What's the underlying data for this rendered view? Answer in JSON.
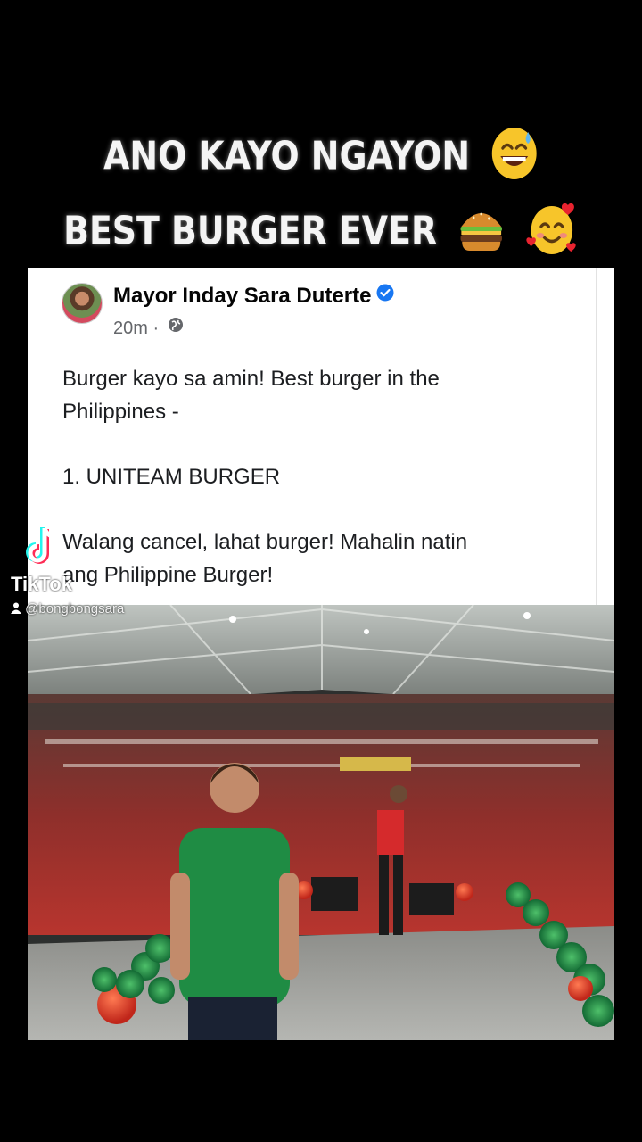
{
  "caption": {
    "line1": "ANO KAYO NGAYON",
    "line1_emoji": "grinning-sweat-emoji",
    "line2": "BEST BURGER EVER",
    "line2_emojis": [
      "hamburger-emoji",
      "smiling-face-with-hearts-emoji"
    ]
  },
  "post": {
    "author": "Mayor Inday Sara Duterte",
    "verified_icon": "verified-badge-icon",
    "time": "20m",
    "separator": "·",
    "privacy_icon": "globe-icon",
    "paragraph1": "Burger kayo sa amin! Best burger in the\nPhilippines -",
    "paragraph2": "1. UNITEAM BURGER",
    "paragraph3": "Walang cancel, lahat burger! Mahalin natin\nang Philippine Burger!"
  },
  "watermark": {
    "brand": "TikTok",
    "user_icon": "person-icon",
    "handle": "@bongbongsara"
  },
  "colors": {
    "background": "#000000",
    "verified_blue": "#1877f2",
    "meta_gray": "#65676b",
    "balloon_green": "#1f8a4a",
    "balloon_red": "#d93a24"
  }
}
